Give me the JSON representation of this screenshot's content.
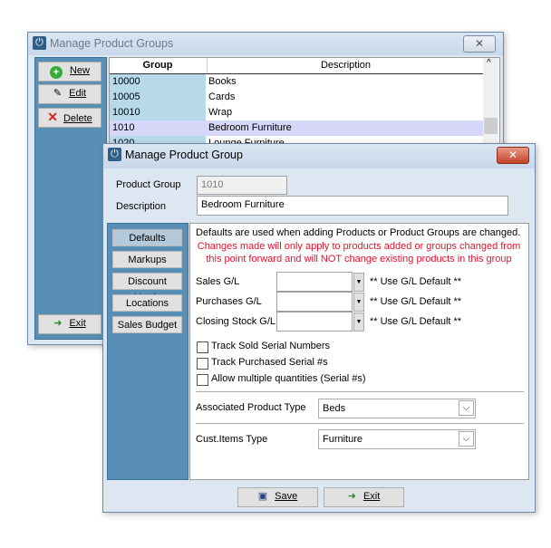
{
  "groups_window": {
    "title": "Manage Product Groups",
    "buttons": {
      "new": "New",
      "edit": "Edit",
      "delete": "Delete",
      "exit": "Exit"
    },
    "columns": [
      "Group",
      "Description"
    ],
    "rows": [
      {
        "group": "10000",
        "description": "Books"
      },
      {
        "group": "10005",
        "description": "Cards"
      },
      {
        "group": "10010",
        "description": "Wrap"
      },
      {
        "group": "1010",
        "description": "Bedroom Furniture",
        "selected": true
      },
      {
        "group": "1020",
        "description": "Lounge Furniture"
      }
    ]
  },
  "group_dialog": {
    "title": "Manage Product Group",
    "product_group_label": "Product Group",
    "product_group_value": "1010",
    "description_label": "Description",
    "description_value": "Bedroom Furniture",
    "tabs": [
      "Defaults",
      "Markups",
      "Discount Matrix",
      "Locations",
      "Sales Budget"
    ],
    "active_tab": "Defaults",
    "info_text": "Defaults are used when adding Products or Product Groups are changed.",
    "warning_line1": "Changes made will only apply to products added or groups changed from",
    "warning_line2": "this point forward and will NOT change existing products in this group",
    "gl": [
      {
        "label": "Sales G/L",
        "hint": "** Use G/L Default **"
      },
      {
        "label": "Purchases G/L",
        "hint": "** Use G/L Default **"
      },
      {
        "label": "Closing Stock G/L",
        "hint": "** Use G/L Default **"
      }
    ],
    "checkboxes": [
      {
        "label": "Track Sold Serial Numbers",
        "checked": false
      },
      {
        "label": "Track Purchased Serial #s",
        "checked": false
      },
      {
        "label": "Allow multiple quantities (Serial #s)",
        "checked": false
      }
    ],
    "assoc_type_label": "Associated Product Type",
    "assoc_type_value": "Beds",
    "cust_items_label": "Cust.Items Type",
    "cust_items_value": "Furniture",
    "save": "Save",
    "exit": "Exit"
  },
  "colors": {
    "panel_blue": "#5a8fb5",
    "warning_red": "#e8112d",
    "selected_row": "#d6d6f8",
    "group_col": "#b8d9ea"
  }
}
